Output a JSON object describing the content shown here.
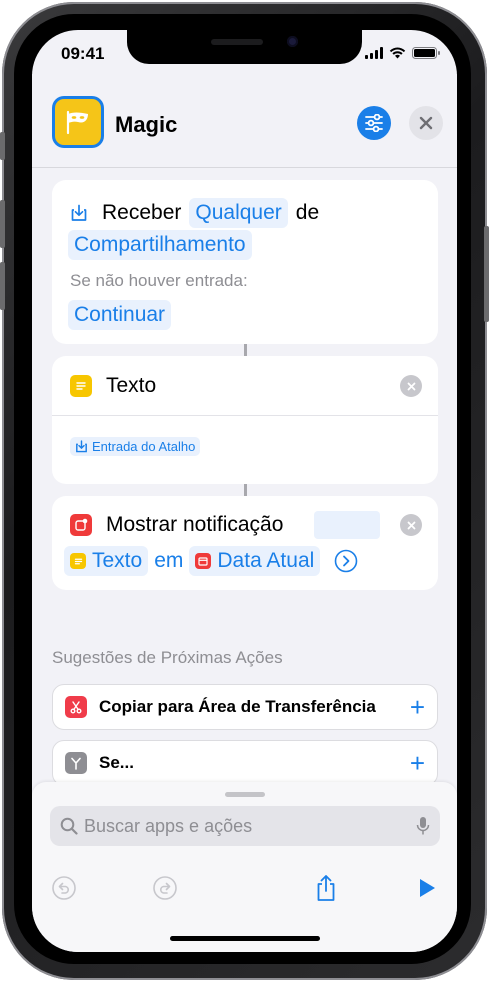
{
  "status": {
    "time": "09:41"
  },
  "header": {
    "title": "Magic"
  },
  "actions": {
    "receive": {
      "verb": "Receber",
      "type_chip": "Qualquer",
      "connector": "de",
      "source_chip": "Compartilhamento",
      "fallback_label": "Se não houver entrada:",
      "fallback_chip": "Continuar"
    },
    "text": {
      "title": "Texto",
      "variable_chip": "Entrada do Atalho"
    },
    "notify": {
      "title": "Mostrar notificação",
      "var1": "Texto",
      "middle": "em",
      "var2": "Data Atual"
    }
  },
  "suggestions": {
    "title": "Sugestões de Próximas Ações",
    "items": [
      {
        "label": "Copiar para Área de Transferência",
        "icon": "scissors-icon"
      },
      {
        "label": "Se...",
        "icon": "branch-icon"
      }
    ]
  },
  "search": {
    "placeholder": "Buscar apps e ações"
  },
  "colors": {
    "accent": "#1a7fe8",
    "text_icon": "#f7c600",
    "notify_icon": "#ef3a3a",
    "clipboard_icon": "#f03c4a",
    "if_icon": "#8e8e93"
  }
}
